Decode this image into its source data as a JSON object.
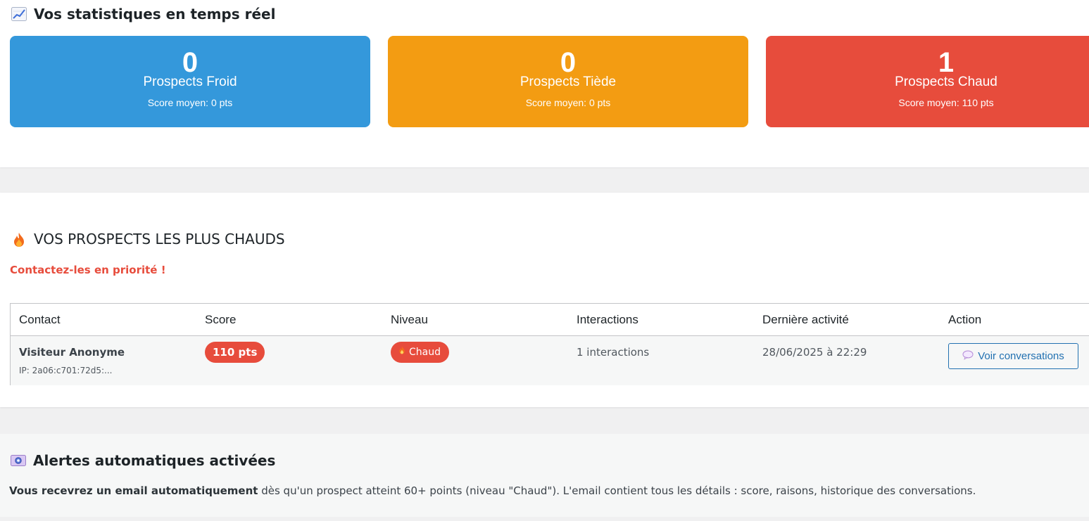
{
  "stats": {
    "title": "Vos statistiques en temps réel",
    "icon": "chart-increasing-icon",
    "cards": [
      {
        "count": "0",
        "label": "Prospects Froid",
        "avg": "Score moyen: 0 pts",
        "color": "#3498db"
      },
      {
        "count": "0",
        "label": "Prospects Tiède",
        "avg": "Score moyen: 0 pts",
        "color": "#f39c12"
      },
      {
        "count": "1",
        "label": "Prospects Chaud",
        "avg": "Score moyen: 110 pts",
        "color": "#e74c3c"
      }
    ]
  },
  "hot": {
    "title": "VOS PROSPECTS LES PLUS CHAUDS",
    "icon": "fire-icon",
    "subtitle": "Contactez-les en priorité !",
    "table": {
      "headers": [
        "Contact",
        "Score",
        "Niveau",
        "Interactions",
        "Dernière activité",
        "Action"
      ],
      "rows": [
        {
          "name": "Visiteur Anonyme",
          "ip": "IP: 2a06:c701:72d5:...",
          "score": "110 pts",
          "level": "Chaud",
          "interactions": "1 interactions",
          "last_activity": "28/06/2025 à 22:29",
          "action": "Voir conversations"
        }
      ]
    }
  },
  "alerts": {
    "title": "Alertes automatiques activées",
    "icon": "email-envelope-icon",
    "text_bold": "Vous recevrez un email automatiquement",
    "text_rest": " dès qu'un prospect atteint 60+ points (niveau \"Chaud\"). L'email contient tous les détails : score, raisons, historique des conversations."
  },
  "colors": {
    "cold": "#3498db",
    "warm": "#f39c12",
    "hot": "#e74c3c",
    "link": "#2271b1"
  }
}
